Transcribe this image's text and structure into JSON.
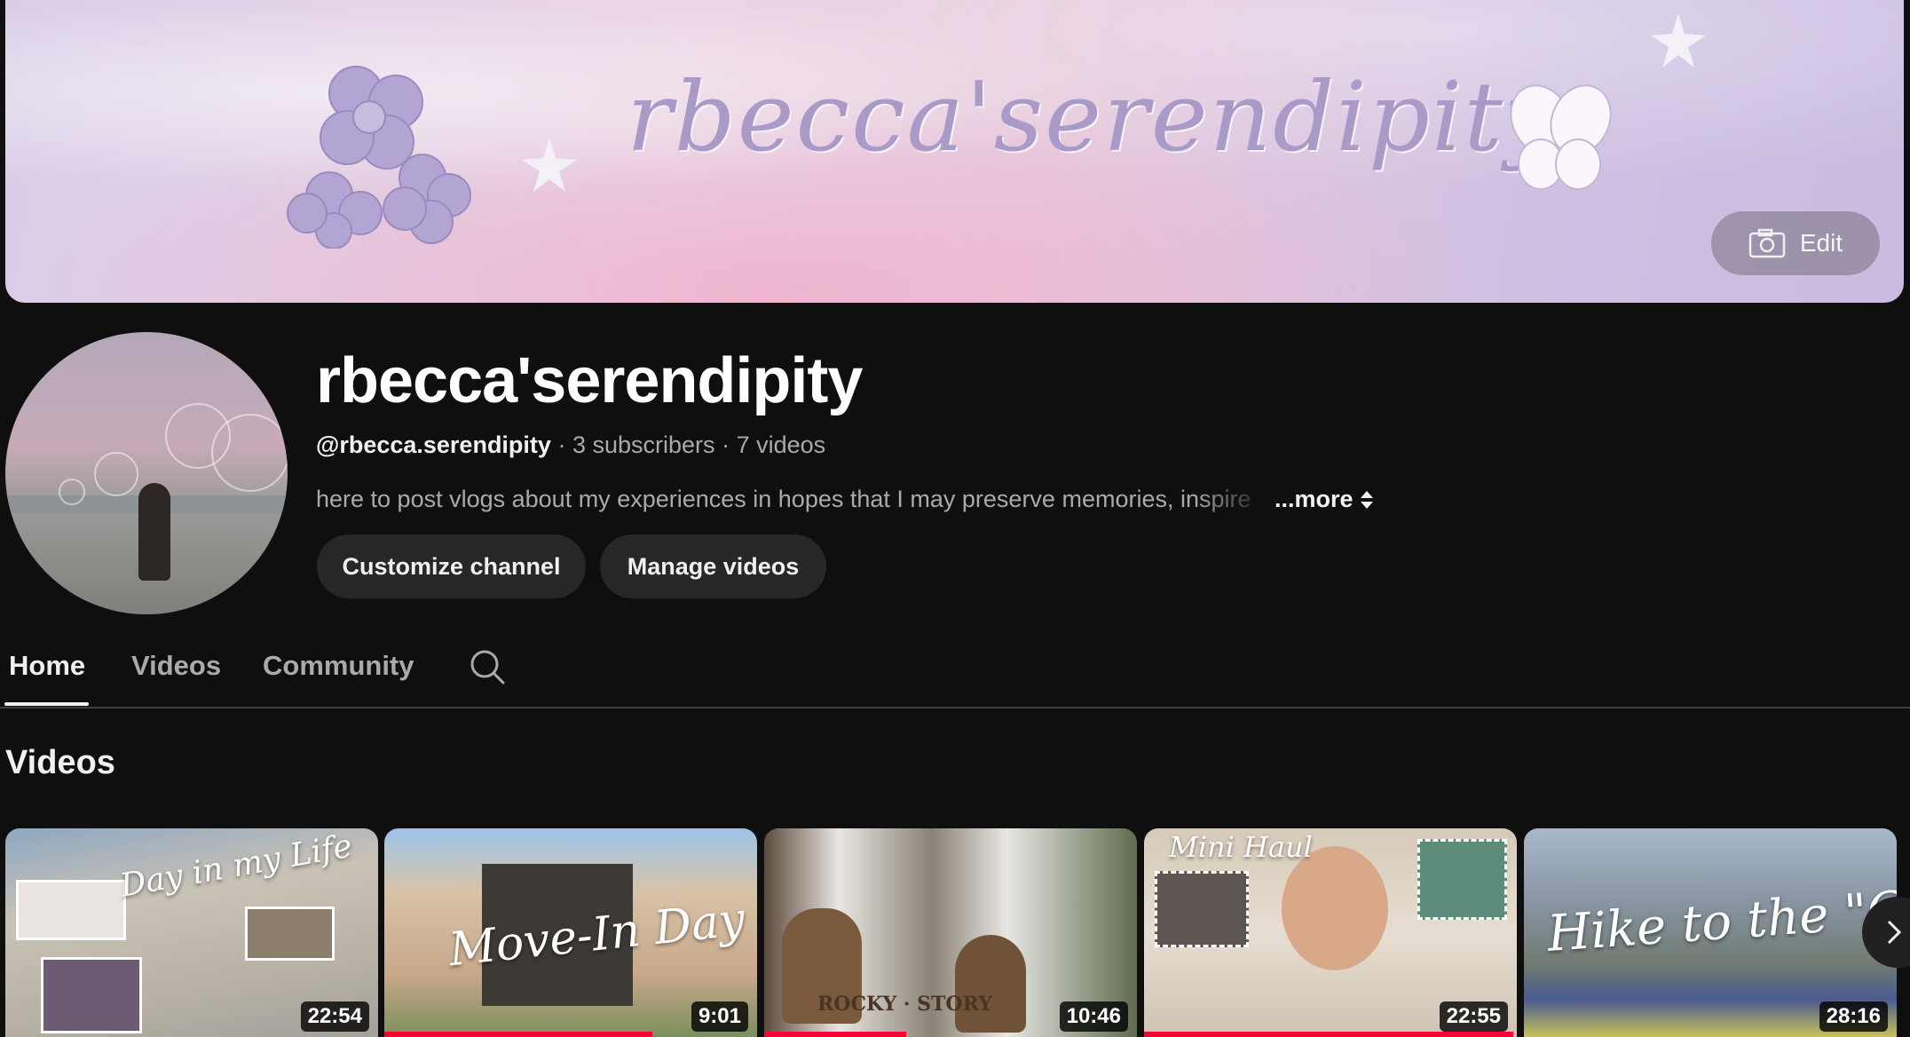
{
  "banner": {
    "script_text": "rbecca'serendipity",
    "edit_label": "Edit"
  },
  "channel": {
    "name": "rbecca'serendipity",
    "handle": "@rbecca.serendipity",
    "subscribers": "3 subscribers",
    "videos_count": "7 videos",
    "separator": "·",
    "description": "here to post vlogs about my experiences in hopes that I may preserve memories, inspire",
    "more_label": "...more"
  },
  "buttons": {
    "customize": "Customize channel",
    "manage": "Manage videos"
  },
  "tabs": [
    {
      "label": "Home",
      "active": true
    },
    {
      "label": "Videos",
      "active": false
    },
    {
      "label": "Community",
      "active": false
    }
  ],
  "section": {
    "title": "Videos"
  },
  "videos": [
    {
      "caption": "Day in my Life",
      "duration": "22:54",
      "progress": 0.0
    },
    {
      "caption": "Move-In Day",
      "duration": "9:01",
      "progress": 0.72
    },
    {
      "caption": "ROCKY · STORY",
      "duration": "10:46",
      "progress": 0.38
    },
    {
      "caption": "Mini Haul",
      "duration": "22:55",
      "progress": 0.99
    },
    {
      "caption": "Hike to the \"C\"",
      "duration": "28:16",
      "progress": 0.0
    }
  ],
  "colors": {
    "background": "#0f0f0f",
    "chip": "#272727",
    "progress": "#ff0033",
    "muted_text": "#aaaaaa"
  }
}
